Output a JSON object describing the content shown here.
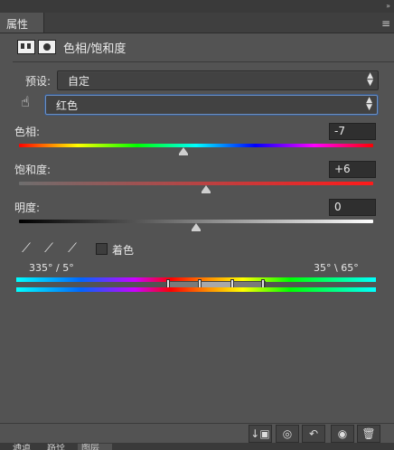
{
  "tabs": {
    "properties_label": "属性"
  },
  "header": {
    "title": "色相/饱和度",
    "icons": [
      "adjustment-layer-icon",
      "mask-icon"
    ]
  },
  "preset": {
    "label": "预设:",
    "value": "自定"
  },
  "channel": {
    "value": "红色"
  },
  "hue": {
    "label": "色相:",
    "value": "-7"
  },
  "saturation": {
    "label": "饱和度:",
    "value": "+6"
  },
  "lightness": {
    "label": "明度:",
    "value": "0"
  },
  "colorize": {
    "label": "着色",
    "checked": false
  },
  "range": {
    "left": "335° / 5°",
    "right": "35° \\ 65°"
  },
  "toolbar": {
    "buttons": [
      "clip-to-layer-icon",
      "view-previous-icon",
      "reset-icon",
      "visibility-icon",
      "delete-icon"
    ]
  },
  "bottom_tabs": [
    "通道",
    "路径",
    "图层"
  ],
  "colors": {
    "panel_bg": "#535353",
    "field_bg": "#2f2f2f",
    "focus_border": "#6b8fc2"
  }
}
